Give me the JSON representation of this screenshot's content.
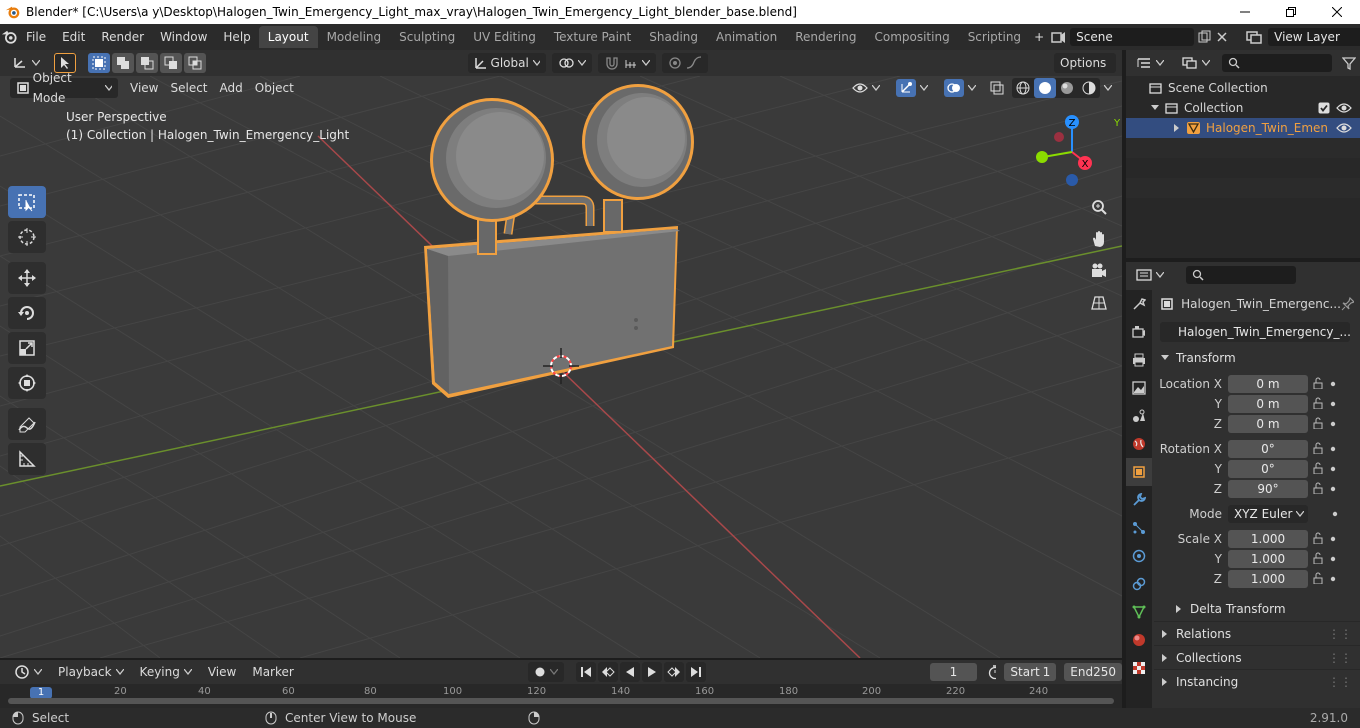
{
  "window": {
    "title": "Blender* [C:\\Users\\a y\\Desktop\\Halogen_Twin_Emergency_Light_max_vray\\Halogen_Twin_Emergency_Light_blender_base.blend]"
  },
  "menu": {
    "items": [
      "File",
      "Edit",
      "Render",
      "Window",
      "Help"
    ]
  },
  "workspaces": {
    "tabs": [
      "Layout",
      "Modeling",
      "Sculpting",
      "UV Editing",
      "Texture Paint",
      "Shading",
      "Animation",
      "Rendering",
      "Compositing",
      "Scripting"
    ],
    "active": "Layout",
    "add": "+"
  },
  "scene": {
    "name": "Scene"
  },
  "view_layer": {
    "name": "View Layer"
  },
  "viewport": {
    "mode": "Object Mode",
    "menus": [
      "View",
      "Select",
      "Add",
      "Object"
    ],
    "transform_orientation": "Global",
    "options_label": "Options",
    "perspective_label": "User Perspective",
    "collection_label": "(1) Collection | Halogen_Twin_Emergency_Light",
    "gizmo_axes": {
      "z": "Z",
      "y": "Y",
      "x": "X"
    }
  },
  "outliner": {
    "scene_collection": "Scene Collection",
    "collection": "Collection",
    "object": "Halogen_Twin_Emen"
  },
  "properties": {
    "object_name": "Halogen_Twin_Emergenc...",
    "data_name": "Halogen_Twin_Emergency_...",
    "transform_label": "Transform",
    "location": {
      "label": "Location X",
      "x": "0 m",
      "y": "0 m",
      "z": "0 m"
    },
    "rotation": {
      "label": "Rotation X",
      "x": "0°",
      "y": "0°",
      "z": "90°"
    },
    "mode_label": "Mode",
    "mode_value": "XYZ Euler",
    "scale": {
      "label": "Scale X",
      "x": "1.000",
      "y": "1.000",
      "z": "1.000"
    },
    "axis_y": "Y",
    "axis_z": "Z",
    "delta_transform": "Delta Transform",
    "sections": [
      "Relations",
      "Collections",
      "Instancing"
    ]
  },
  "timeline": {
    "menus": [
      "Playback",
      "Keying",
      "View",
      "Marker"
    ],
    "current_frame": "1",
    "start_label": "Start",
    "start_value": "1",
    "end_label": "End",
    "end_value": "250",
    "ruler_ticks": [
      "1",
      "20",
      "40",
      "60",
      "80",
      "100",
      "120",
      "140",
      "160",
      "180",
      "200",
      "220",
      "240"
    ]
  },
  "status": {
    "select": "Select",
    "center_view": "Center View to Mouse",
    "version": "2.91.0"
  },
  "colors": {
    "selection_outline": "#f0a040",
    "active_blue": "#4772b3",
    "x_axis": "#ff3352",
    "y_axis": "#8bdc00",
    "z_axis": "#2890ff"
  }
}
